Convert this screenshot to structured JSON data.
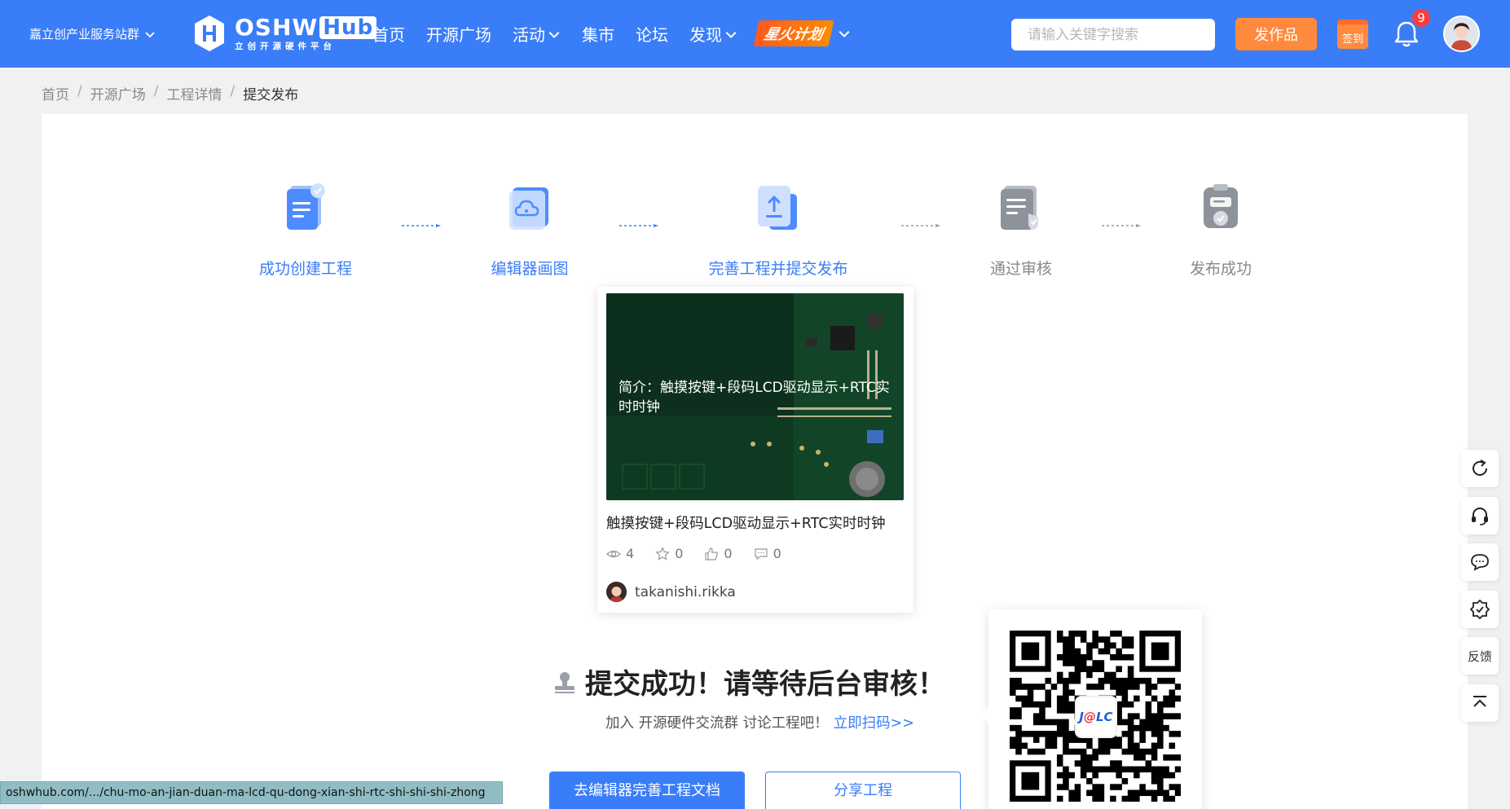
{
  "header": {
    "cluster_label": "嘉立创产业服务站群",
    "logo_main": "OSHW",
    "logo_hub": "Hub",
    "logo_sub": "立创开源硬件平台",
    "nav": [
      {
        "label": "首页",
        "has_dropdown": false
      },
      {
        "label": "开源广场",
        "has_dropdown": false
      },
      {
        "label": "活动",
        "has_dropdown": true
      },
      {
        "label": "集市",
        "has_dropdown": false
      },
      {
        "label": "论坛",
        "has_dropdown": false
      },
      {
        "label": "发现",
        "has_dropdown": true
      }
    ],
    "spark_label": "星火计划",
    "search_placeholder": "请输入关键字搜索",
    "publish_label": "发作品",
    "signin_label": "签到",
    "notification_count": "9"
  },
  "breadcrumb": {
    "items": [
      "首页",
      "开源广场",
      "工程详情"
    ],
    "current": "提交发布"
  },
  "steps": [
    {
      "label": "成功创建工程",
      "state": "done"
    },
    {
      "label": "编辑器画图",
      "state": "done"
    },
    {
      "label": "完善工程并提交发布",
      "state": "done"
    },
    {
      "label": "通过审核",
      "state": "pending"
    },
    {
      "label": "发布成功",
      "state": "pending"
    }
  ],
  "project": {
    "description": "简介：触摸按键+段码LCD驱动显示+RTC实时时钟",
    "title": "触摸按键+段码LCD驱动显示+RTC实时时钟",
    "views": "4",
    "stars": "0",
    "likes": "0",
    "comments": "0",
    "author": "takanishi.rikka"
  },
  "success": {
    "message": "提交成功！请等待后台审核！",
    "join_text": "加入 开源硬件交流群 讨论工程吧！",
    "join_link": "立即扫码>>",
    "qr_logo_a": "J",
    "qr_logo_at": "@",
    "qr_logo_b": "LC"
  },
  "actions": {
    "editor_button": "去编辑器完善工程文档",
    "share_button": "分享工程"
  },
  "rail": {
    "feedback_label": "反馈"
  },
  "status_url": "oshwhub.com/.../chu-mo-an-jian-duan-ma-lcd-qu-dong-xian-shi-rtc-shi-shi-shi-zhong",
  "colors": {
    "brand_blue": "#3a7df8",
    "accent_orange": "#ff8a3d",
    "badge_red": "#ff3b3b"
  }
}
